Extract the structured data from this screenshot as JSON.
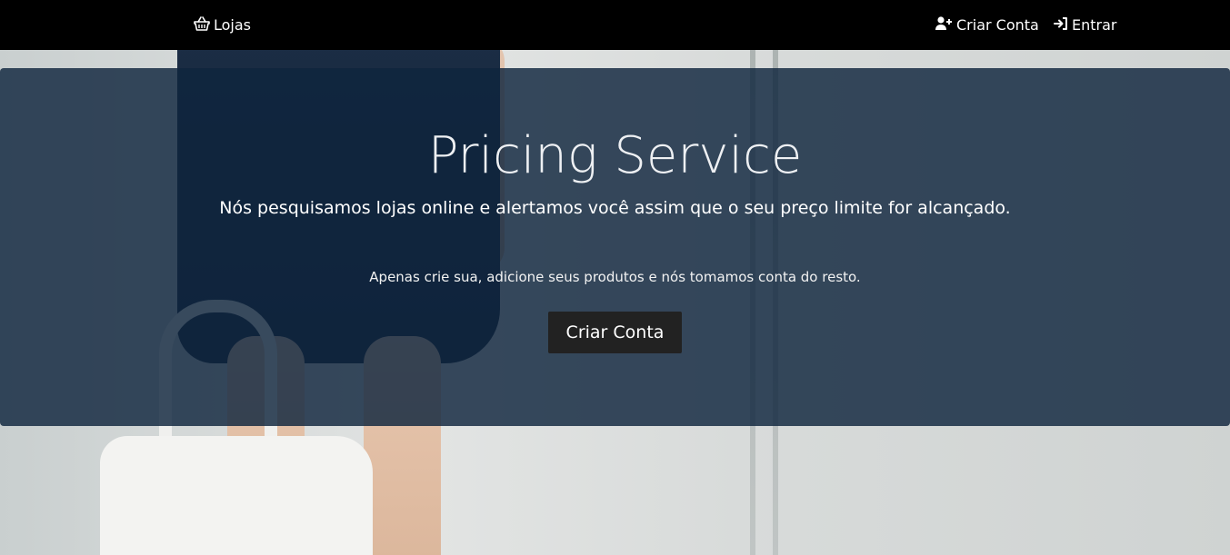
{
  "navbar": {
    "stores_label": "Lojas",
    "stores_icon": "shopping-basket-icon",
    "signup_label": "Criar Conta",
    "signup_icon": "user-plus-icon",
    "login_label": "Entrar",
    "login_icon": "sign-in-icon",
    "background_color": "#000000"
  },
  "hero": {
    "title": "Pricing Service",
    "lead": "Nós pesquisamos lojas online e alertamos você assim que o seu preço limite for alcançado.",
    "subtext": "Apenas crie sua, adicione seus produtos e nós tomamos conta do resto.",
    "cta_label": "Criar Conta",
    "overlay_color": "#0f243d",
    "button_color": "#222222"
  }
}
